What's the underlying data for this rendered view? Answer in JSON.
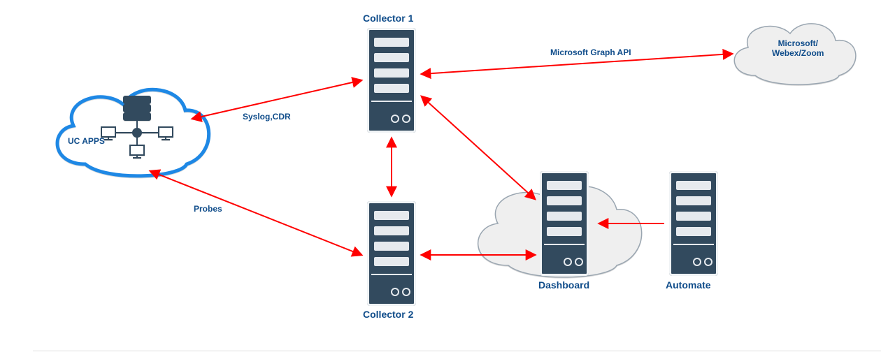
{
  "nodes": {
    "uc_apps": {
      "label": "UC APPS"
    },
    "collector1": {
      "label": "Collector 1"
    },
    "collector2": {
      "label": "Collector 2"
    },
    "dashboard": {
      "label": "Dashboard"
    },
    "automate": {
      "label": "Automate"
    },
    "cloud_vendors": {
      "label": "Microsoft/\nWebex/Zoom"
    }
  },
  "connections": {
    "syslog_cdr": {
      "label": "Syslog,CDR"
    },
    "probes": {
      "label": "Probes"
    },
    "graph_api": {
      "label": "Microsoft Graph API"
    }
  },
  "colors": {
    "arrow": "#ff0000",
    "label": "#0f4c8a",
    "server_body": "#324a5e",
    "cloud_blue": "#1e88e5",
    "cloud_grey_fill": "#efefef",
    "cloud_grey_stroke": "#9aa6b1"
  }
}
